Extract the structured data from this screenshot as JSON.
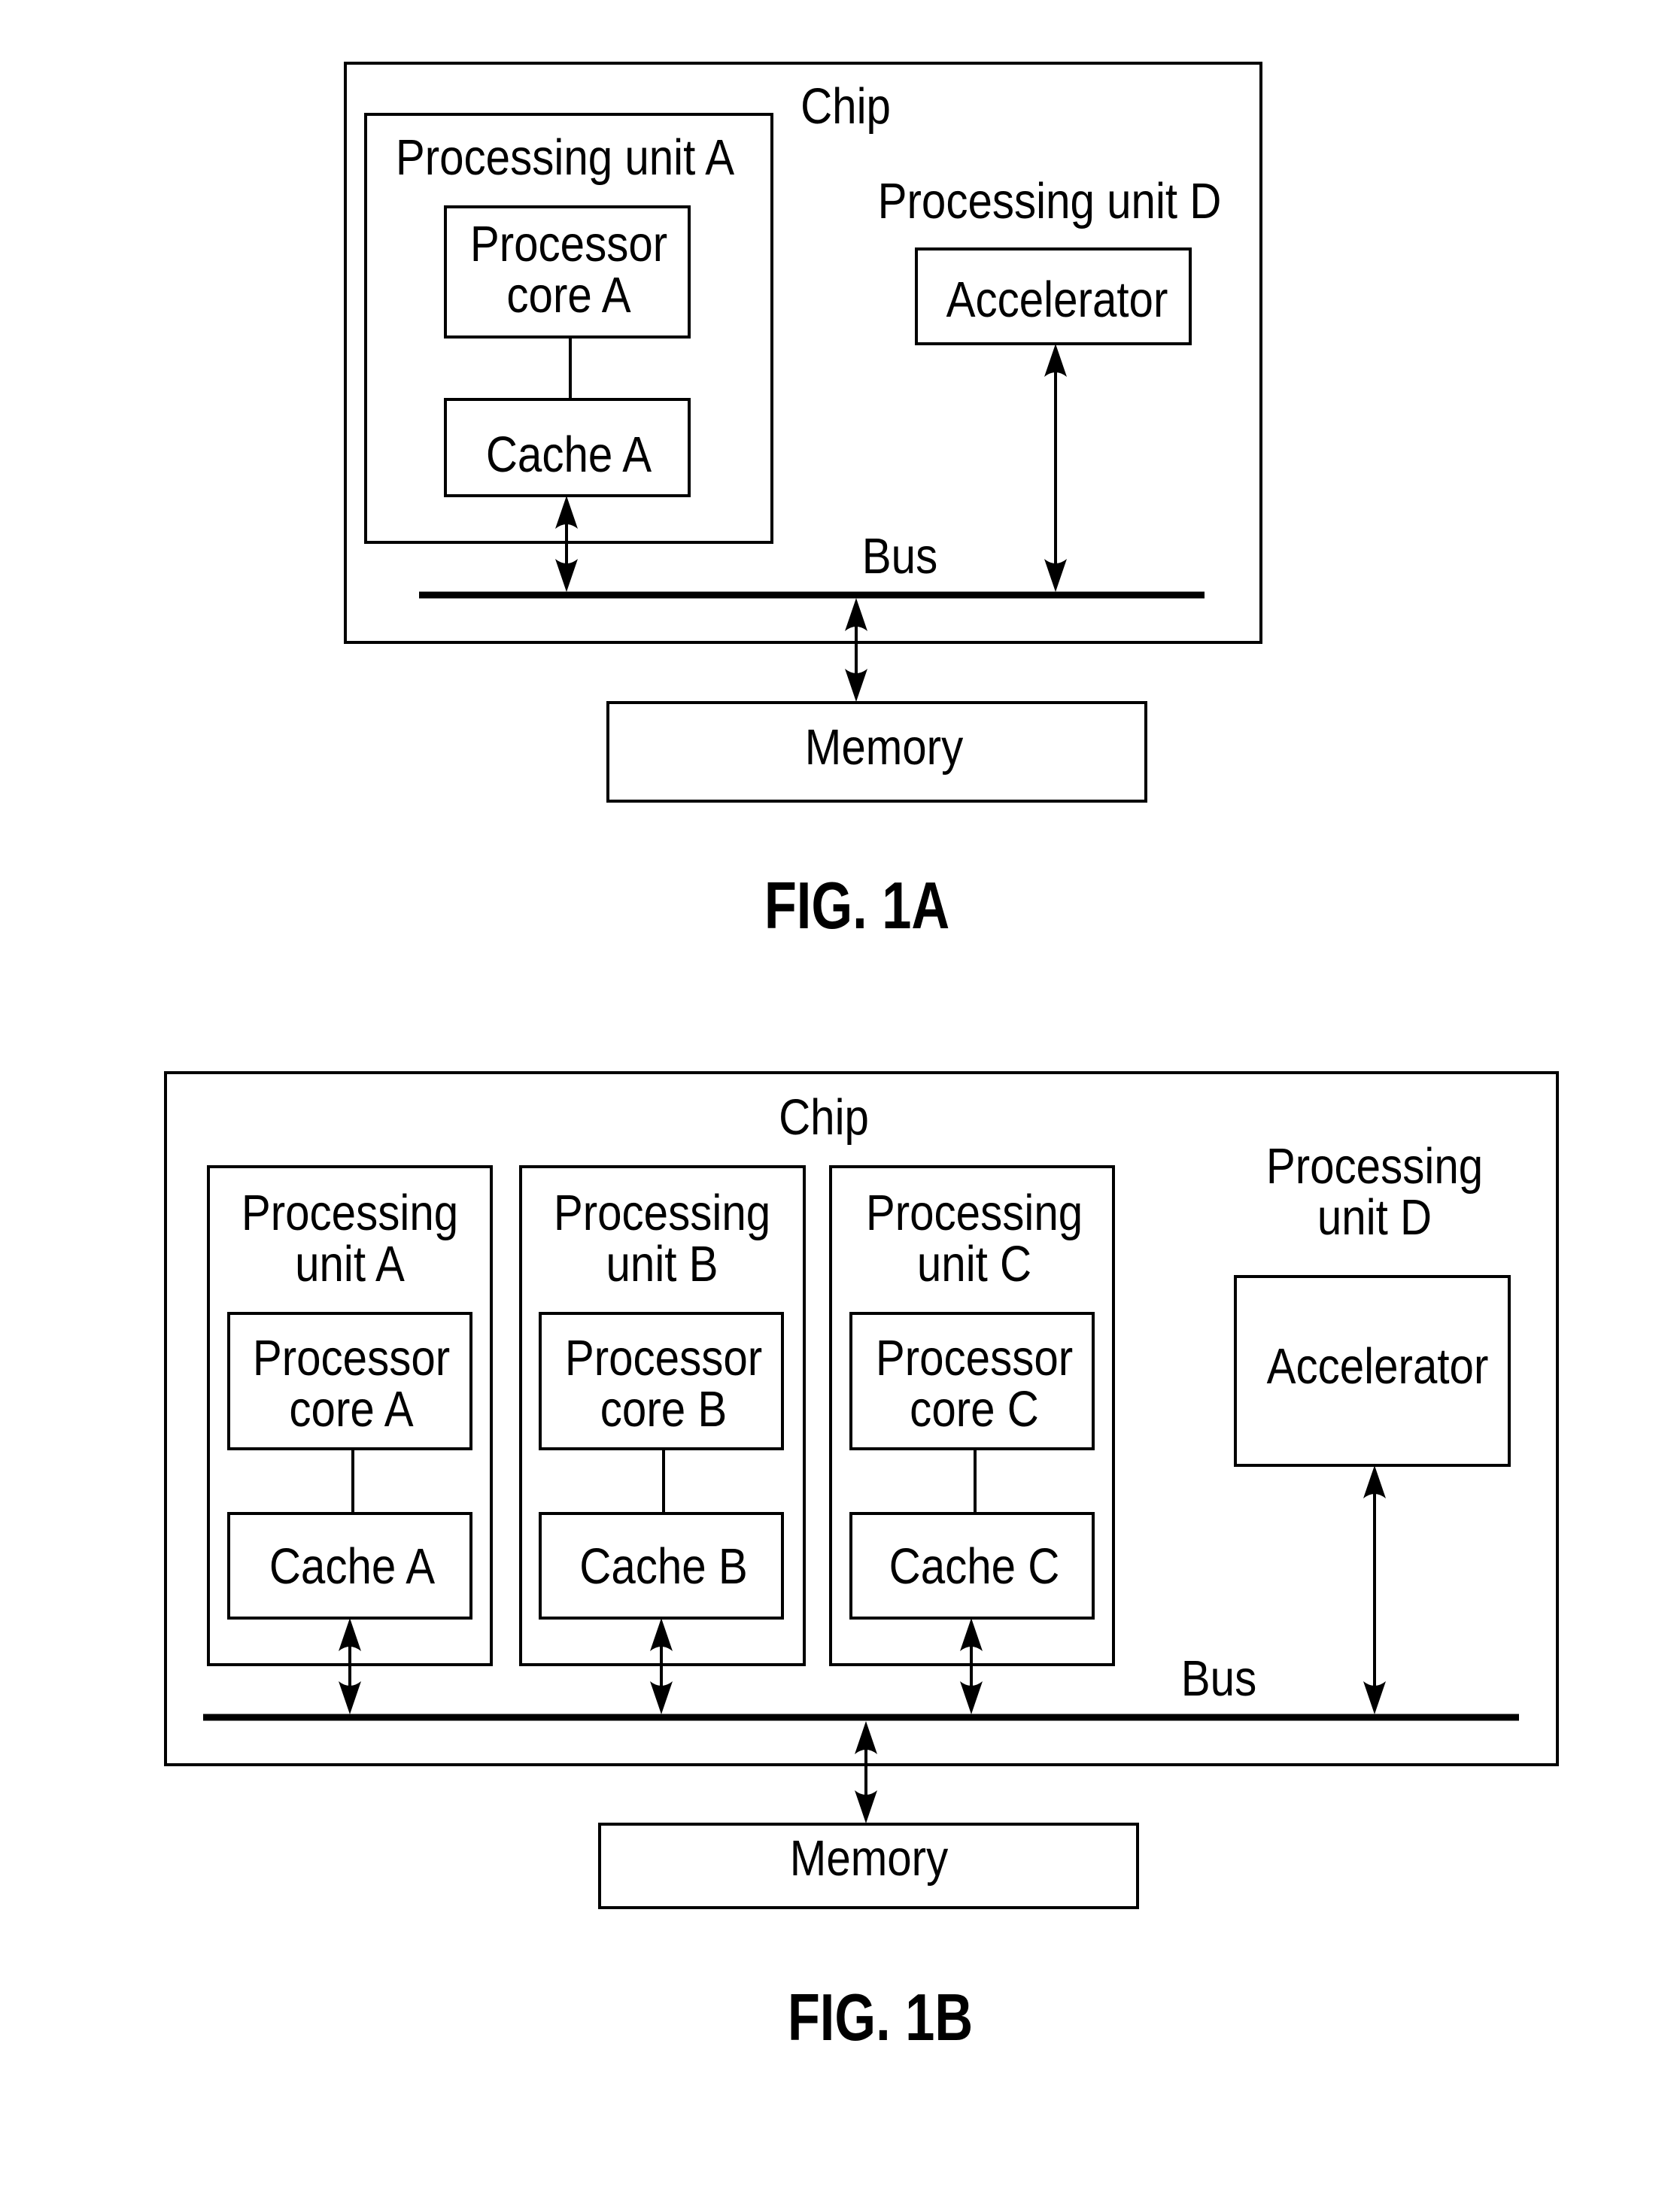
{
  "figures": [
    {
      "id": "fig1a",
      "caption": "FIG. 1A",
      "chip_label": "Chip",
      "bus_label": "Bus",
      "memory_label": "Memory",
      "processing_units": [
        {
          "label_lines": [
            "Processing unit A"
          ],
          "core_lines": [
            "Processor",
            "core A"
          ],
          "cache_label": "Cache A"
        }
      ],
      "accelerator_unit": {
        "label_lines": [
          "Processing unit D"
        ],
        "accelerator_label": "Accelerator"
      },
      "connections": [
        {
          "from": "Processor core A",
          "to": "Cache A",
          "type": "line"
        },
        {
          "from": "Cache A",
          "to": "Bus",
          "type": "bidirectional-arrow"
        },
        {
          "from": "Accelerator",
          "to": "Bus",
          "type": "bidirectional-arrow"
        },
        {
          "from": "Bus",
          "to": "Memory",
          "type": "bidirectional-arrow"
        }
      ]
    },
    {
      "id": "fig1b",
      "caption": "FIG. 1B",
      "chip_label": "Chip",
      "bus_label": "Bus",
      "memory_label": "Memory",
      "processing_units": [
        {
          "label_lines": [
            "Processing",
            "unit A"
          ],
          "core_lines": [
            "Processor",
            "core A"
          ],
          "cache_label": "Cache A"
        },
        {
          "label_lines": [
            "Processing",
            "unit B"
          ],
          "core_lines": [
            "Processor",
            "core B"
          ],
          "cache_label": "Cache B"
        },
        {
          "label_lines": [
            "Processing",
            "unit C"
          ],
          "core_lines": [
            "Processor",
            "core C"
          ],
          "cache_label": "Cache C"
        }
      ],
      "accelerator_unit": {
        "label_lines": [
          "Processing",
          "unit D"
        ],
        "accelerator_label": "Accelerator"
      },
      "connections": [
        {
          "from": "Processor core A",
          "to": "Cache A",
          "type": "line"
        },
        {
          "from": "Processor core B",
          "to": "Cache B",
          "type": "line"
        },
        {
          "from": "Processor core C",
          "to": "Cache C",
          "type": "line"
        },
        {
          "from": "Cache A",
          "to": "Bus",
          "type": "bidirectional-arrow"
        },
        {
          "from": "Cache B",
          "to": "Bus",
          "type": "bidirectional-arrow"
        },
        {
          "from": "Cache C",
          "to": "Bus",
          "type": "bidirectional-arrow"
        },
        {
          "from": "Accelerator",
          "to": "Bus",
          "type": "bidirectional-arrow"
        },
        {
          "from": "Bus",
          "to": "Memory",
          "type": "bidirectional-arrow"
        }
      ]
    }
  ]
}
